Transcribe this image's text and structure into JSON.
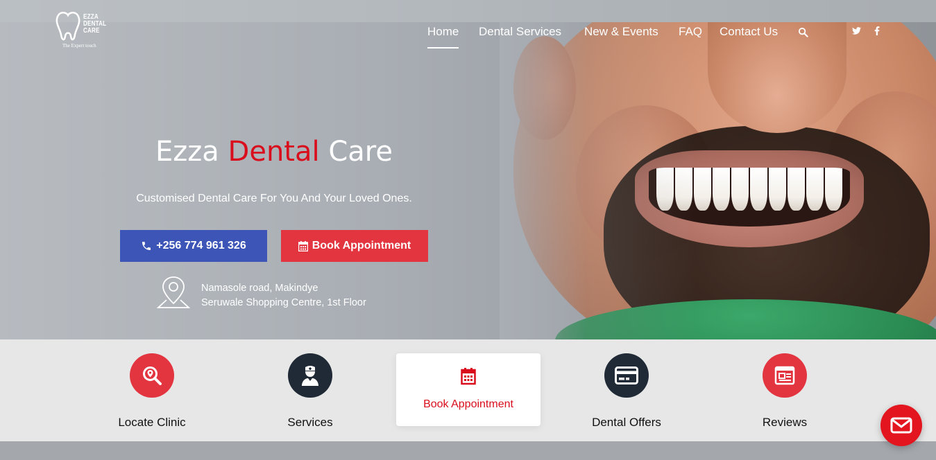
{
  "brand": {
    "logo_text_lines": [
      "EZZA",
      "DENTAL",
      "CARE"
    ],
    "tagline": "The Expert touch"
  },
  "nav": {
    "items": [
      {
        "label": "Home",
        "active": true
      },
      {
        "label": "Dental Services"
      },
      {
        "label": "New & Events"
      },
      {
        "label": "FAQ"
      },
      {
        "label": "Contact Us"
      }
    ],
    "search_icon": "search-icon",
    "social": [
      "twitter-icon",
      "facebook-icon"
    ]
  },
  "hero": {
    "title_part1": "Ezza",
    "title_part2": "Dental",
    "title_part3": "Care",
    "subtitle": "Customised Dental Care For You And Your Loved Ones.",
    "phone_button": "+256 774 961 326",
    "book_button": "Book Appointment",
    "address_line1": "Namasole road, Makindye",
    "address_line2": "Seruwale Shopping Centre, 1st Floor"
  },
  "quick_links": [
    {
      "label": "Locate Clinic",
      "icon": "locate-icon"
    },
    {
      "label": "Services",
      "icon": "dentist-icon"
    },
    {
      "label": "Book Appointment",
      "icon": "calendar-icon",
      "highlighted": true
    },
    {
      "label": "Dental Offers",
      "icon": "card-icon"
    },
    {
      "label": "Reviews",
      "icon": "reviews-icon"
    }
  ],
  "colors": {
    "accent_red": "#e2353f",
    "title_red": "#d90d1c",
    "phone_blue": "#3d55b6",
    "dark_circle": "#1f2a36"
  }
}
